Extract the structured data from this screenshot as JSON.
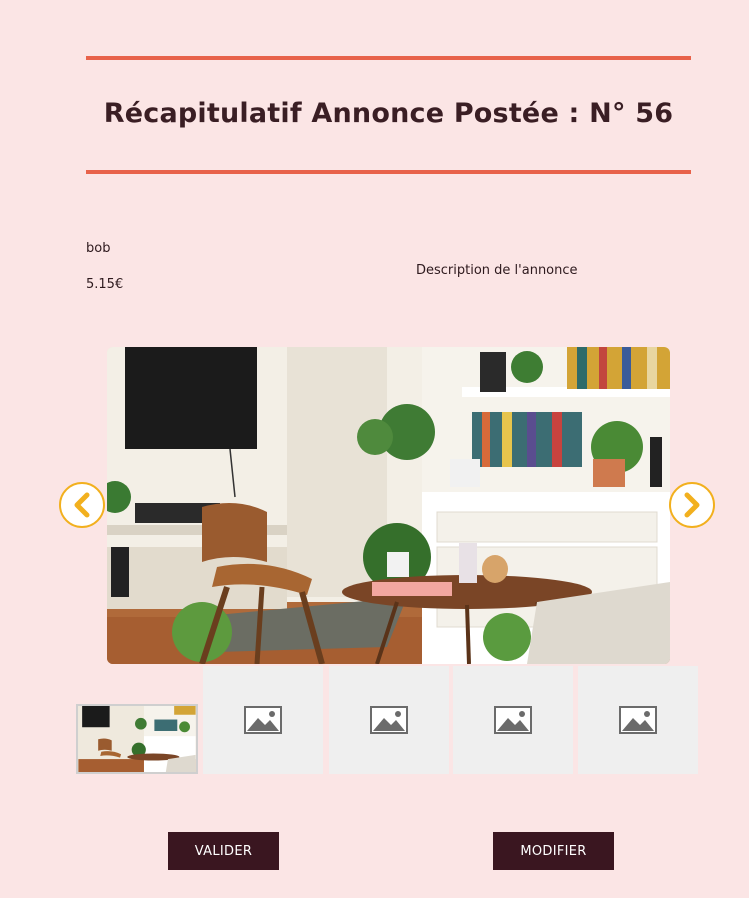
{
  "header": {
    "title": "Récapitulatif Annonce Postée : N° 56"
  },
  "listing": {
    "name": "bob",
    "price": "5.15€",
    "description": "Description de l'annonce"
  },
  "gallery": {
    "prev_icon": "chevron-left-icon",
    "next_icon": "chevron-right-icon",
    "accent_color": "#f2b01e",
    "thumbnails": [
      {
        "type": "photo",
        "active": true
      },
      {
        "type": "placeholder",
        "icon": "image-placeholder-icon"
      },
      {
        "type": "placeholder",
        "icon": "image-placeholder-icon"
      },
      {
        "type": "placeholder",
        "icon": "image-placeholder-icon"
      },
      {
        "type": "placeholder",
        "icon": "image-placeholder-icon"
      }
    ]
  },
  "actions": {
    "validate_label": "VALIDER",
    "modify_label": "MODIFIER"
  },
  "colors": {
    "background": "#fbe5e5",
    "rule": "#e8624a",
    "button": "#3a1620"
  }
}
